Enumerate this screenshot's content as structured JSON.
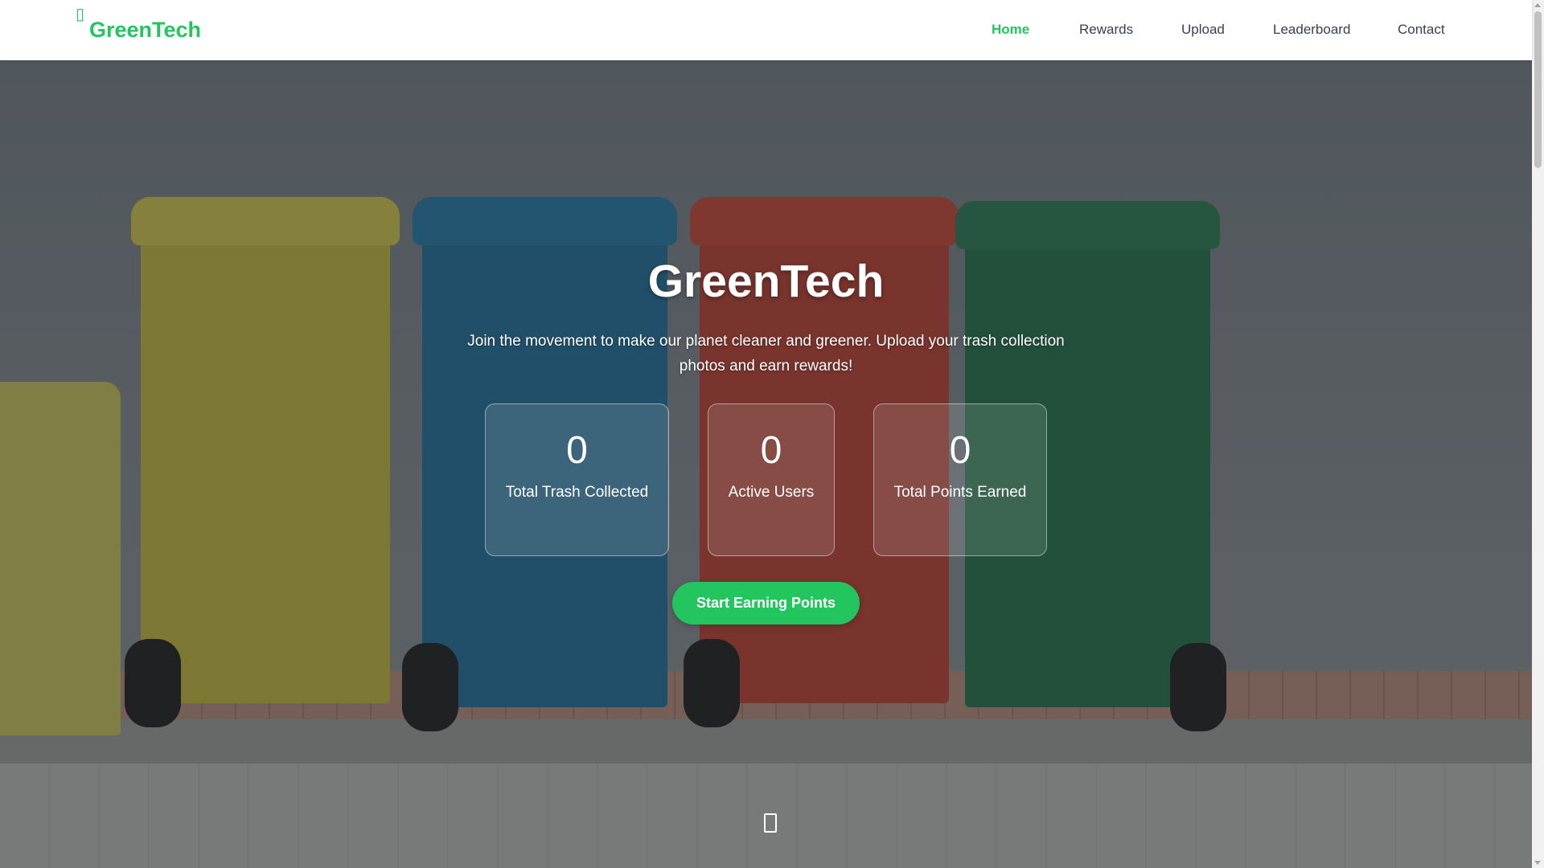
{
  "nav": {
    "brand_icon": "leaf-icon",
    "brand": "GreenTech",
    "items": [
      {
        "label": "Home",
        "active": true
      },
      {
        "label": "Rewards",
        "active": false
      },
      {
        "label": "Upload",
        "active": false
      },
      {
        "label": "Leaderboard",
        "active": false
      },
      {
        "label": "Contact",
        "active": false
      }
    ]
  },
  "hero": {
    "title": "GreenTech",
    "subtitle": "Join the movement to make our planet cleaner and greener. Upload your trash collection photos and earn rewards!",
    "stats": [
      {
        "value": "0",
        "label": "Total Trash Collected"
      },
      {
        "value": "0",
        "label": "Active Users"
      },
      {
        "value": "0",
        "label": "Total Points Earned"
      }
    ],
    "cta_label": "Start Earning Points",
    "scroll_icon": "mouse-scroll-icon"
  },
  "colors": {
    "accent": "#22c55e",
    "nav_text": "#374151",
    "hero_text": "#ffffff"
  }
}
